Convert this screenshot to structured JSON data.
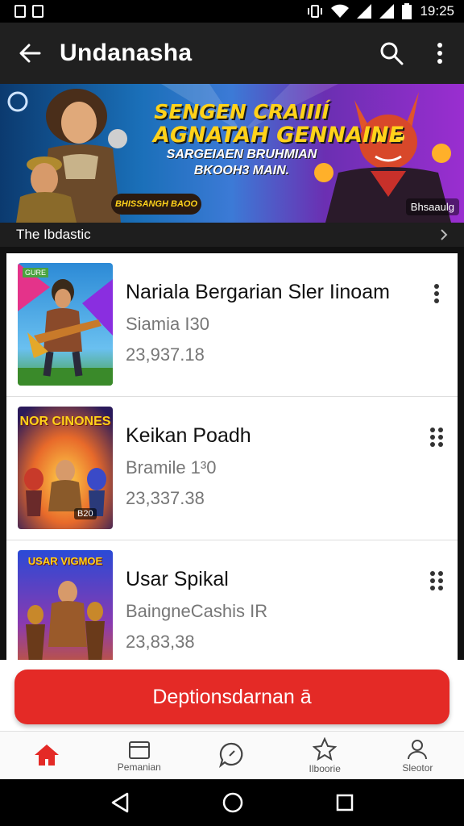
{
  "status_bar": {
    "time": "19:25"
  },
  "app_bar": {
    "title": "Undanasha"
  },
  "banner": {
    "line1": "SENGEN CRAIIIÍ",
    "line2": "AGNATAH GENNAINE",
    "line3": "SARGEIAEN BRUHMIAN",
    "line4": "BKOOH3 MAIN.",
    "button_label": "BHISSANGH BAOO",
    "badge": "Bhsaaulg"
  },
  "sub_bar": {
    "label": "The Ibdastic"
  },
  "list": {
    "items": [
      {
        "title": "Nariala Bergarian Sler Iinoam",
        "subtitle": "Siamia I30",
        "price": "23,937.18",
        "thumb_label": "GURE"
      },
      {
        "title": "Keikan Poadh",
        "subtitle": "Bramile 1³0",
        "price": "23,337.38",
        "thumb_label": "NOR CINONES",
        "thumb_badge": "B20"
      },
      {
        "title": "Usar Spikal",
        "subtitle": "BaingneCashis IR",
        "price": "23,83,38",
        "thumb_label": "USAR VIGMOE"
      }
    ]
  },
  "cta": {
    "label": "Deptionsdarnan ā"
  },
  "bottom_nav": {
    "items": [
      {
        "label": "",
        "icon": "home-icon"
      },
      {
        "label": "Pemanian",
        "icon": "wallet-icon"
      },
      {
        "label": "",
        "icon": "chat-icon"
      },
      {
        "label": "Ilboorie",
        "icon": "star-icon"
      },
      {
        "label": "Sleotor",
        "icon": "profile-icon"
      }
    ]
  },
  "colors": {
    "accent": "#e42a26",
    "app_bar": "#202020",
    "banner_yellow": "#ffd21a"
  }
}
